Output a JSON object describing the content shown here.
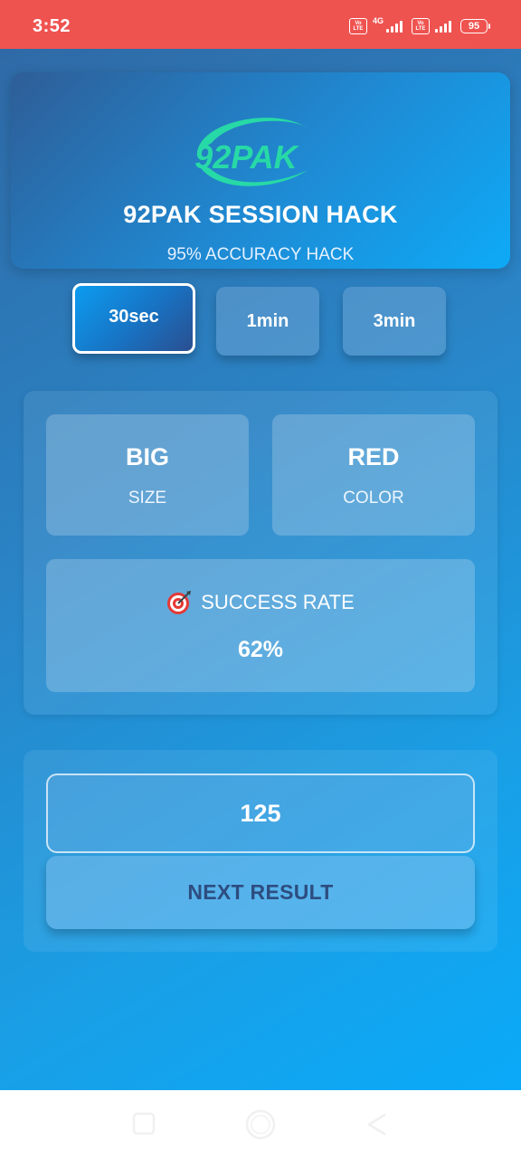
{
  "status_bar": {
    "time": "3:52",
    "volte_top": "Vo",
    "volte_bottom": "LTE",
    "network": "4G",
    "battery": "95"
  },
  "header": {
    "logo_text": "92PAK",
    "title": "92PAK SESSION HACK",
    "subtitle": "95% ACCURACY HACK"
  },
  "time_options": [
    {
      "label": "30sec",
      "active": true
    },
    {
      "label": "1min",
      "active": false
    },
    {
      "label": "3min",
      "active": false
    }
  ],
  "prediction": {
    "size_value": "BIG",
    "size_label": "SIZE",
    "color_value": "RED",
    "color_label": "COLOR",
    "success_rate_label": "SUCCESS RATE",
    "success_rate_value": "62%"
  },
  "period": {
    "number": "125",
    "next_button": "NEXT RESULT"
  },
  "nav_bar": {
    "icons": [
      "recent-apps-icon",
      "home-icon",
      "back-icon"
    ]
  },
  "colors": {
    "status_bar": "#ef5350",
    "accent": "#0aaaf9",
    "logo": "#27d9a6",
    "next_text": "#2d4d80"
  }
}
